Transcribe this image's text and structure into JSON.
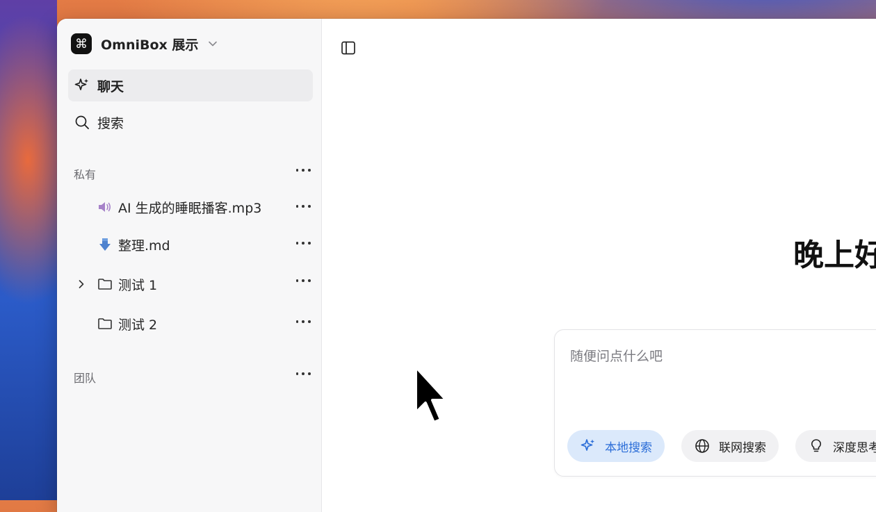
{
  "workspace": {
    "name": "OmniBox 展示",
    "logo_glyph": "⌘"
  },
  "nav": {
    "chat_label": "聊天",
    "search_label": "搜索"
  },
  "sections": {
    "private_label": "私有",
    "team_label": "团队"
  },
  "tree": {
    "items": [
      {
        "label": "AI 生成的睡眠播客.mp3",
        "icon": "speaker-icon"
      },
      {
        "label": "整理.md",
        "icon": "markdown-arrow-icon"
      },
      {
        "label": "测试 1",
        "icon": "folder-icon",
        "expandable": true
      },
      {
        "label": "测试 2",
        "icon": "folder-icon",
        "expandable": false
      }
    ]
  },
  "main": {
    "greeting": "晚上好",
    "composer": {
      "placeholder": "随便问点什么吧",
      "buttons": [
        {
          "label": "本地搜索",
          "icon": "sparkle-icon",
          "active": true
        },
        {
          "label": "联网搜索",
          "icon": "globe-icon",
          "active": false
        },
        {
          "label": "深度思考",
          "icon": "lightbulb-icon",
          "active": false
        }
      ]
    }
  },
  "colors": {
    "accent": "#2c6ed8",
    "accent_bg": "#dbe9fb",
    "sidebar_bg": "#f7f7f8"
  }
}
